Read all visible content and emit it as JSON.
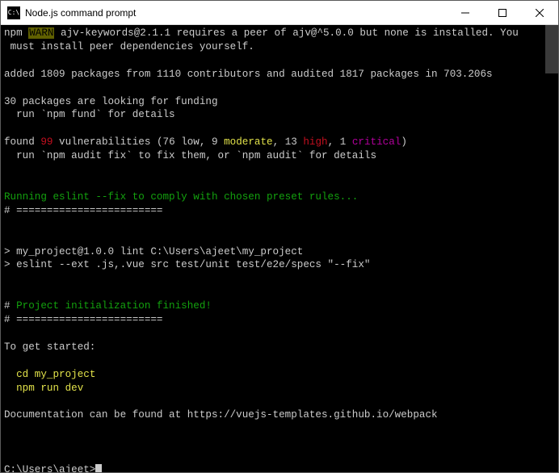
{
  "titlebar": {
    "title": "Node.js command prompt",
    "icon_label": "C:\\"
  },
  "lines": {
    "l1a": "npm ",
    "l1b": "WARN",
    "l1c": " ajv-keywords@2.1.1 requires a peer of ajv@^5.0.0 but none is installed. You",
    "l2": " must install peer dependencies yourself.",
    "l3": "",
    "l4": "added 1809 packages from 1110 contributors and audited 1817 packages in 703.206s",
    "l5": "",
    "l6": "30 packages are looking for funding",
    "l7": "  run `npm fund` for details",
    "l8": "",
    "l9a": "found ",
    "l9b": "99",
    "l9c": " vulnerabilities (76 low, 9 ",
    "l9d": "moderate",
    "l9e": ", 13 ",
    "l9f": "high",
    "l9g": ", 1 ",
    "l9h": "critical",
    "l9i": ")",
    "l10": "  run `npm audit fix` to fix them, or `npm audit` for details",
    "l11": "",
    "l12": "",
    "l13": "Running eslint --fix to comply with chosen preset rules...",
    "l14": "# ========================",
    "l15": "",
    "l16": "",
    "l17": "> my_project@1.0.0 lint C:\\Users\\ajeet\\my_project",
    "l18": "> eslint --ext .js,.vue src test/unit test/e2e/specs \"--fix\"",
    "l19": "",
    "l20": "",
    "l21a": "# ",
    "l21b": "Project initialization finished!",
    "l22": "# ========================",
    "l23": "",
    "l24": "To get started:",
    "l25": "",
    "l26": "  cd my_project",
    "l27": "  npm run dev",
    "l28": "",
    "l29": "Documentation can be found at https://vuejs-templates.github.io/webpack",
    "l30": "",
    "l31": "",
    "l32": "",
    "prompt": "C:\\Users\\ajeet>"
  }
}
